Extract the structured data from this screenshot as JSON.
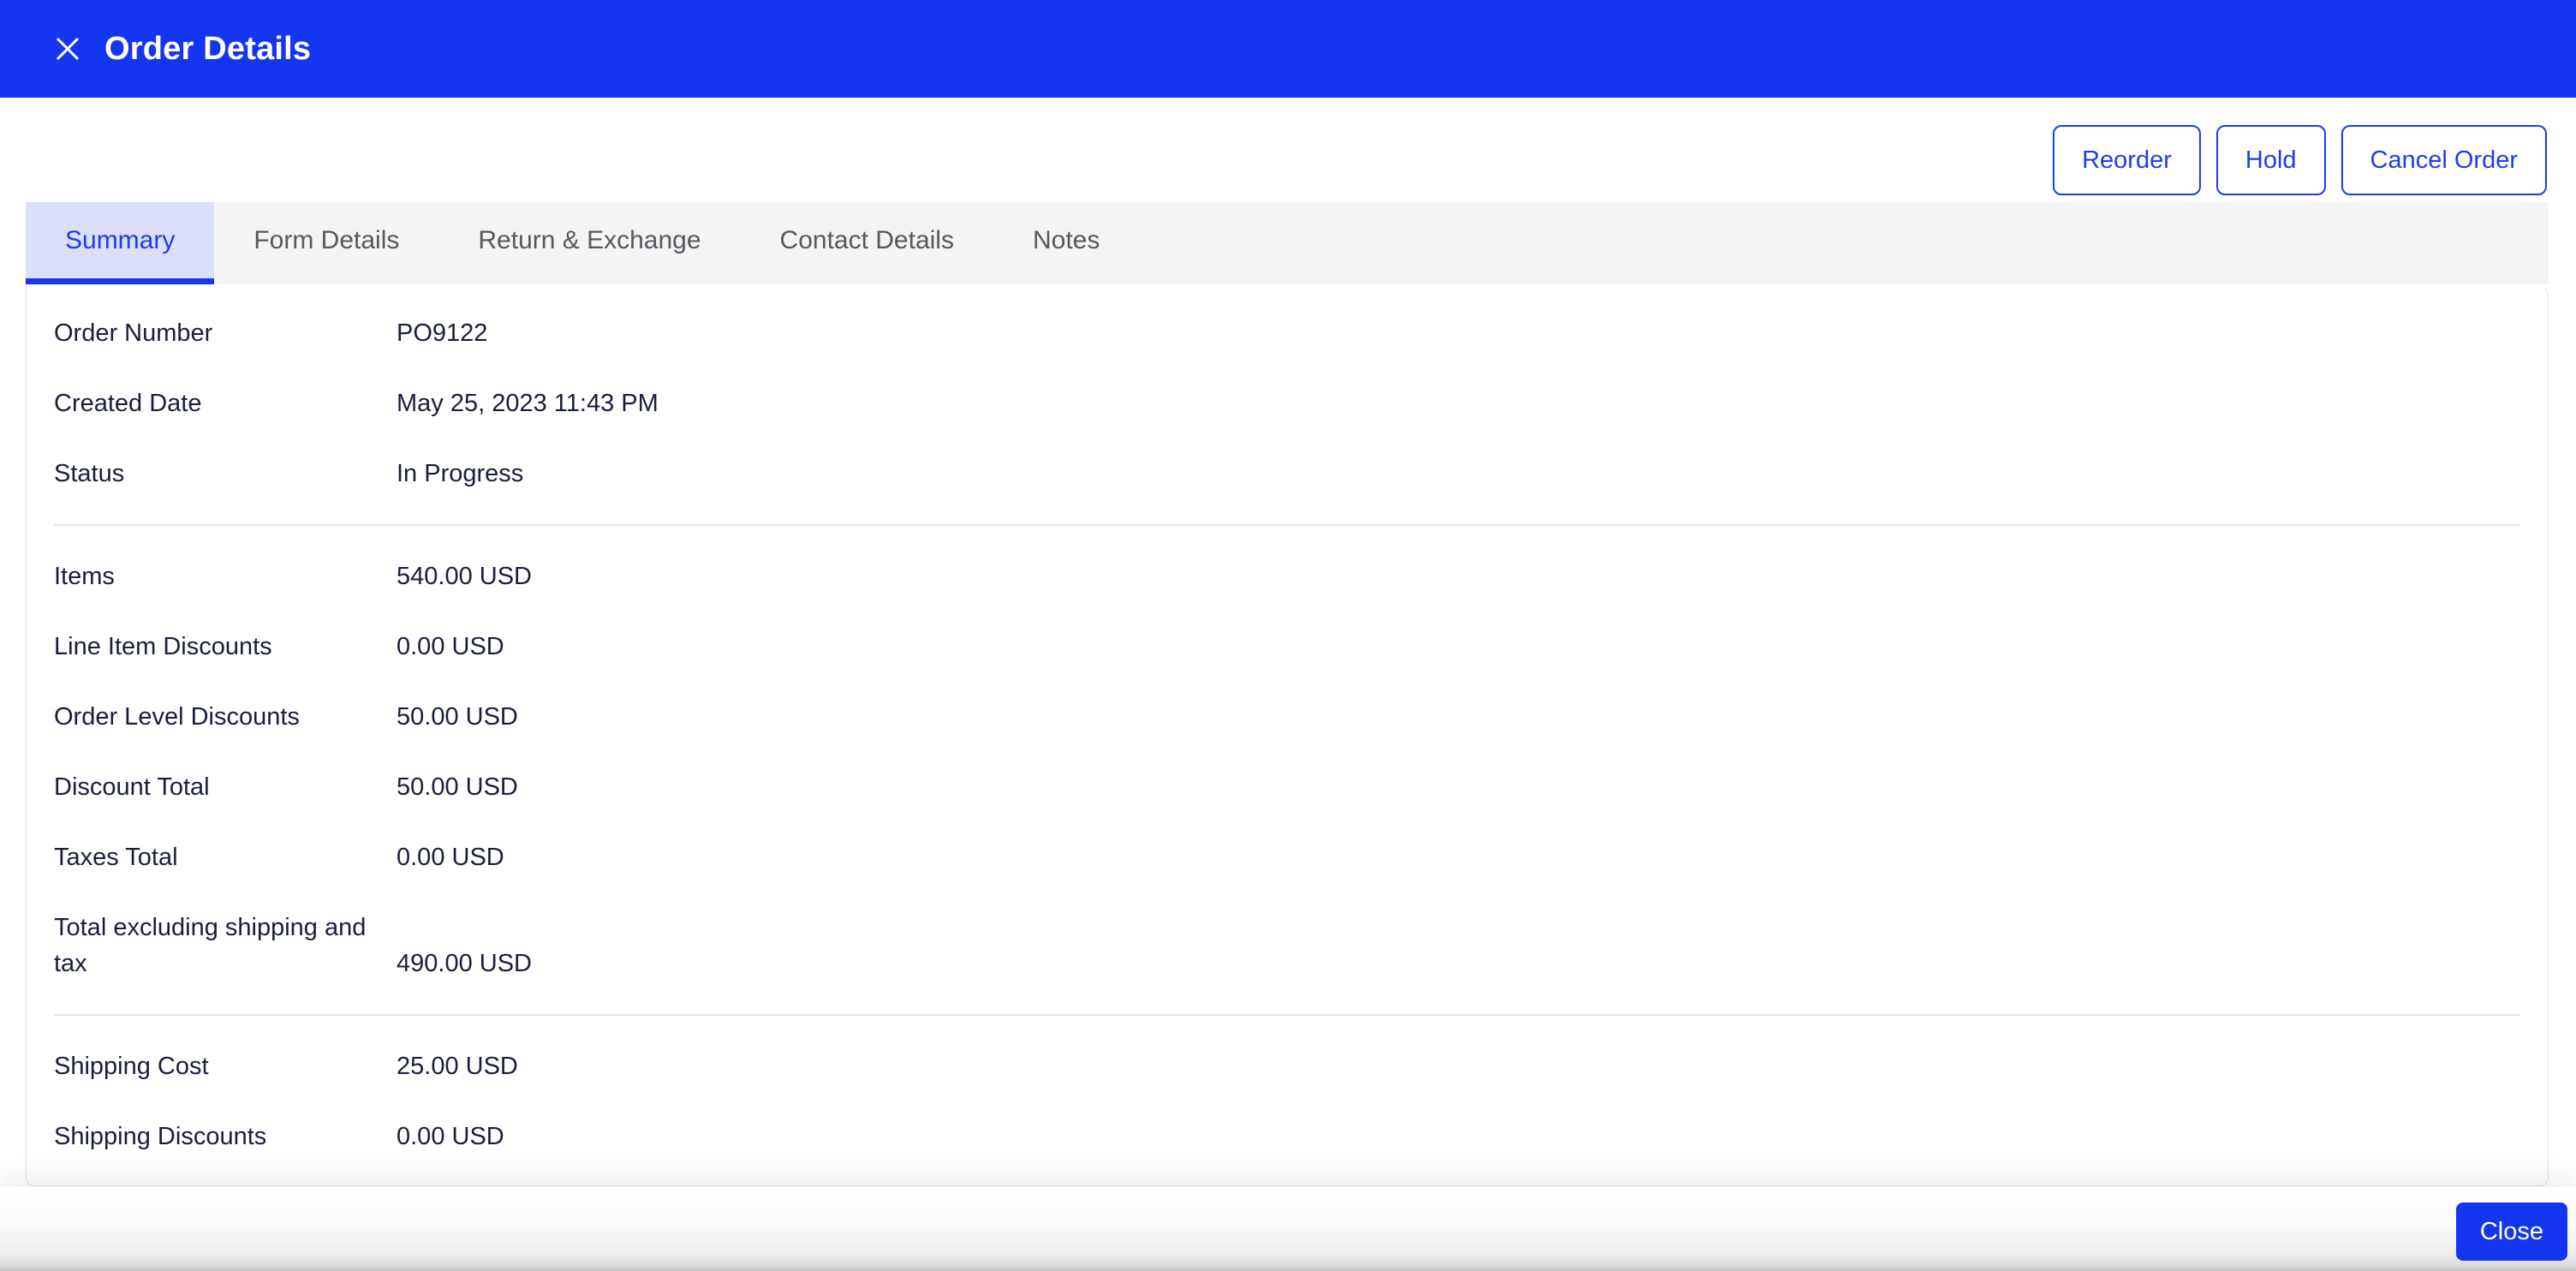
{
  "header": {
    "title": "Order Details"
  },
  "actions": [
    {
      "name": "reorder-button",
      "label": "Reorder"
    },
    {
      "name": "hold-button",
      "label": "Hold"
    },
    {
      "name": "cancel-order-button",
      "label": "Cancel Order"
    }
  ],
  "tabs": [
    {
      "name": "tab-summary",
      "label": "Summary",
      "active": true
    },
    {
      "name": "tab-form-details",
      "label": "Form Details",
      "active": false
    },
    {
      "name": "tab-return-exchange",
      "label": "Return & Exchange",
      "active": false
    },
    {
      "name": "tab-contact-details",
      "label": "Contact Details",
      "active": false
    },
    {
      "name": "tab-notes",
      "label": "Notes",
      "active": false
    }
  ],
  "summary": {
    "groups": [
      [
        {
          "label": "Order Number",
          "value": "PO9122"
        },
        {
          "label": "Created Date",
          "value": "May 25, 2023 11:43 PM"
        },
        {
          "label": "Status",
          "value": "In Progress"
        }
      ],
      [
        {
          "label": "Items",
          "value": "540.00 USD"
        },
        {
          "label": "Line Item Discounts",
          "value": "0.00 USD"
        },
        {
          "label": "Order Level Discounts",
          "value": "50.00 USD"
        },
        {
          "label": "Discount Total",
          "value": "50.00 USD"
        },
        {
          "label": "Taxes Total",
          "value": "0.00 USD"
        },
        {
          "label": "Total excluding shipping and tax",
          "value": "490.00 USD"
        }
      ],
      [
        {
          "label": "Shipping Cost",
          "value": "25.00 USD"
        },
        {
          "label": "Shipping Discounts",
          "value": "0.00 USD"
        }
      ]
    ]
  },
  "footer": {
    "close_label": "Close"
  },
  "colors": {
    "accent": "#1536f0",
    "accent_text": "#1d3cf0",
    "active_tab_bg": "#dbdff8",
    "tab_bar_bg": "#f4f4f5",
    "text_dark": "#1a1e3c",
    "text_muted": "#57575f",
    "border": "#e3e3e6"
  }
}
